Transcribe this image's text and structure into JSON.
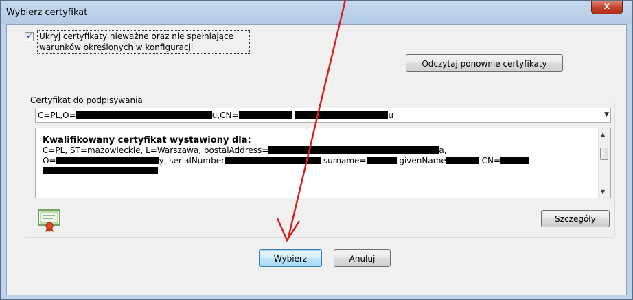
{
  "window": {
    "title": "Wybierz certyfikat",
    "close_glyph": "x"
  },
  "options": {
    "hide_invalid_checked": true,
    "hide_invalid_line1": "Ukryj certyfikaty nieważne oraz nie spełniające",
    "hide_invalid_line2": "warunków określonych w konfiguracji",
    "refresh_label": "Odczytaj ponownie certyfikaty"
  },
  "certificate": {
    "group_label": "Certyfikat do podpisywania",
    "selected_prefix": "C=PL,O=",
    "selected_mid": "u,CN=",
    "selected_tail": "u",
    "info_heading": "Kwalifikowany certyfikat wystawiony dla:",
    "info_line1_a": "C=PL, ST=mazowieckie, L=Warszawa, postalAddress=",
    "info_line1_b": "a,",
    "info_line2_a": "O=",
    "info_line2_b": "y, serialNumber",
    "info_line2_c": "surname=",
    "info_line2_d": "givenName",
    "info_line2_e": "CN=",
    "details_label": "Szczegóły"
  },
  "actions": {
    "choose_label": "Wybierz",
    "cancel_label": "Anuluj"
  },
  "colors": {
    "annotation_arrow": "#d92020"
  }
}
